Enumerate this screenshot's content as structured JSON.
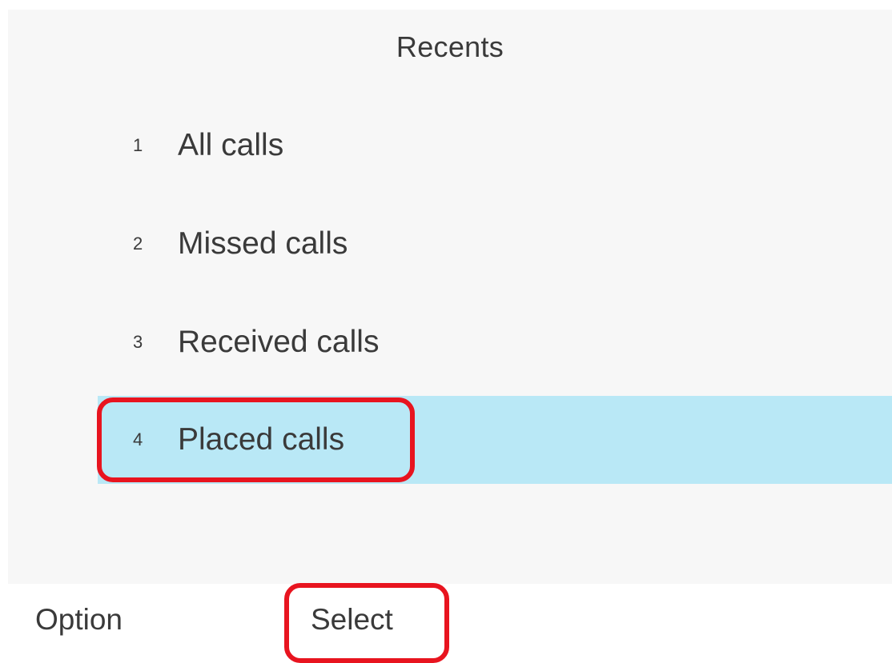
{
  "header": {
    "title": "Recents"
  },
  "menu": {
    "items": [
      {
        "number": "1",
        "label": "All calls"
      },
      {
        "number": "2",
        "label": "Missed calls"
      },
      {
        "number": "3",
        "label": "Received calls"
      },
      {
        "number": "4",
        "label": "Placed calls"
      }
    ],
    "selected_index": 3
  },
  "softkeys": {
    "option_label": "Option",
    "select_label": "Select"
  },
  "colors": {
    "selected_row": "#b9e8f6",
    "annotation_outline": "#e8141f",
    "screen_background": "#f7f7f7",
    "text": "#3a3a3a"
  }
}
